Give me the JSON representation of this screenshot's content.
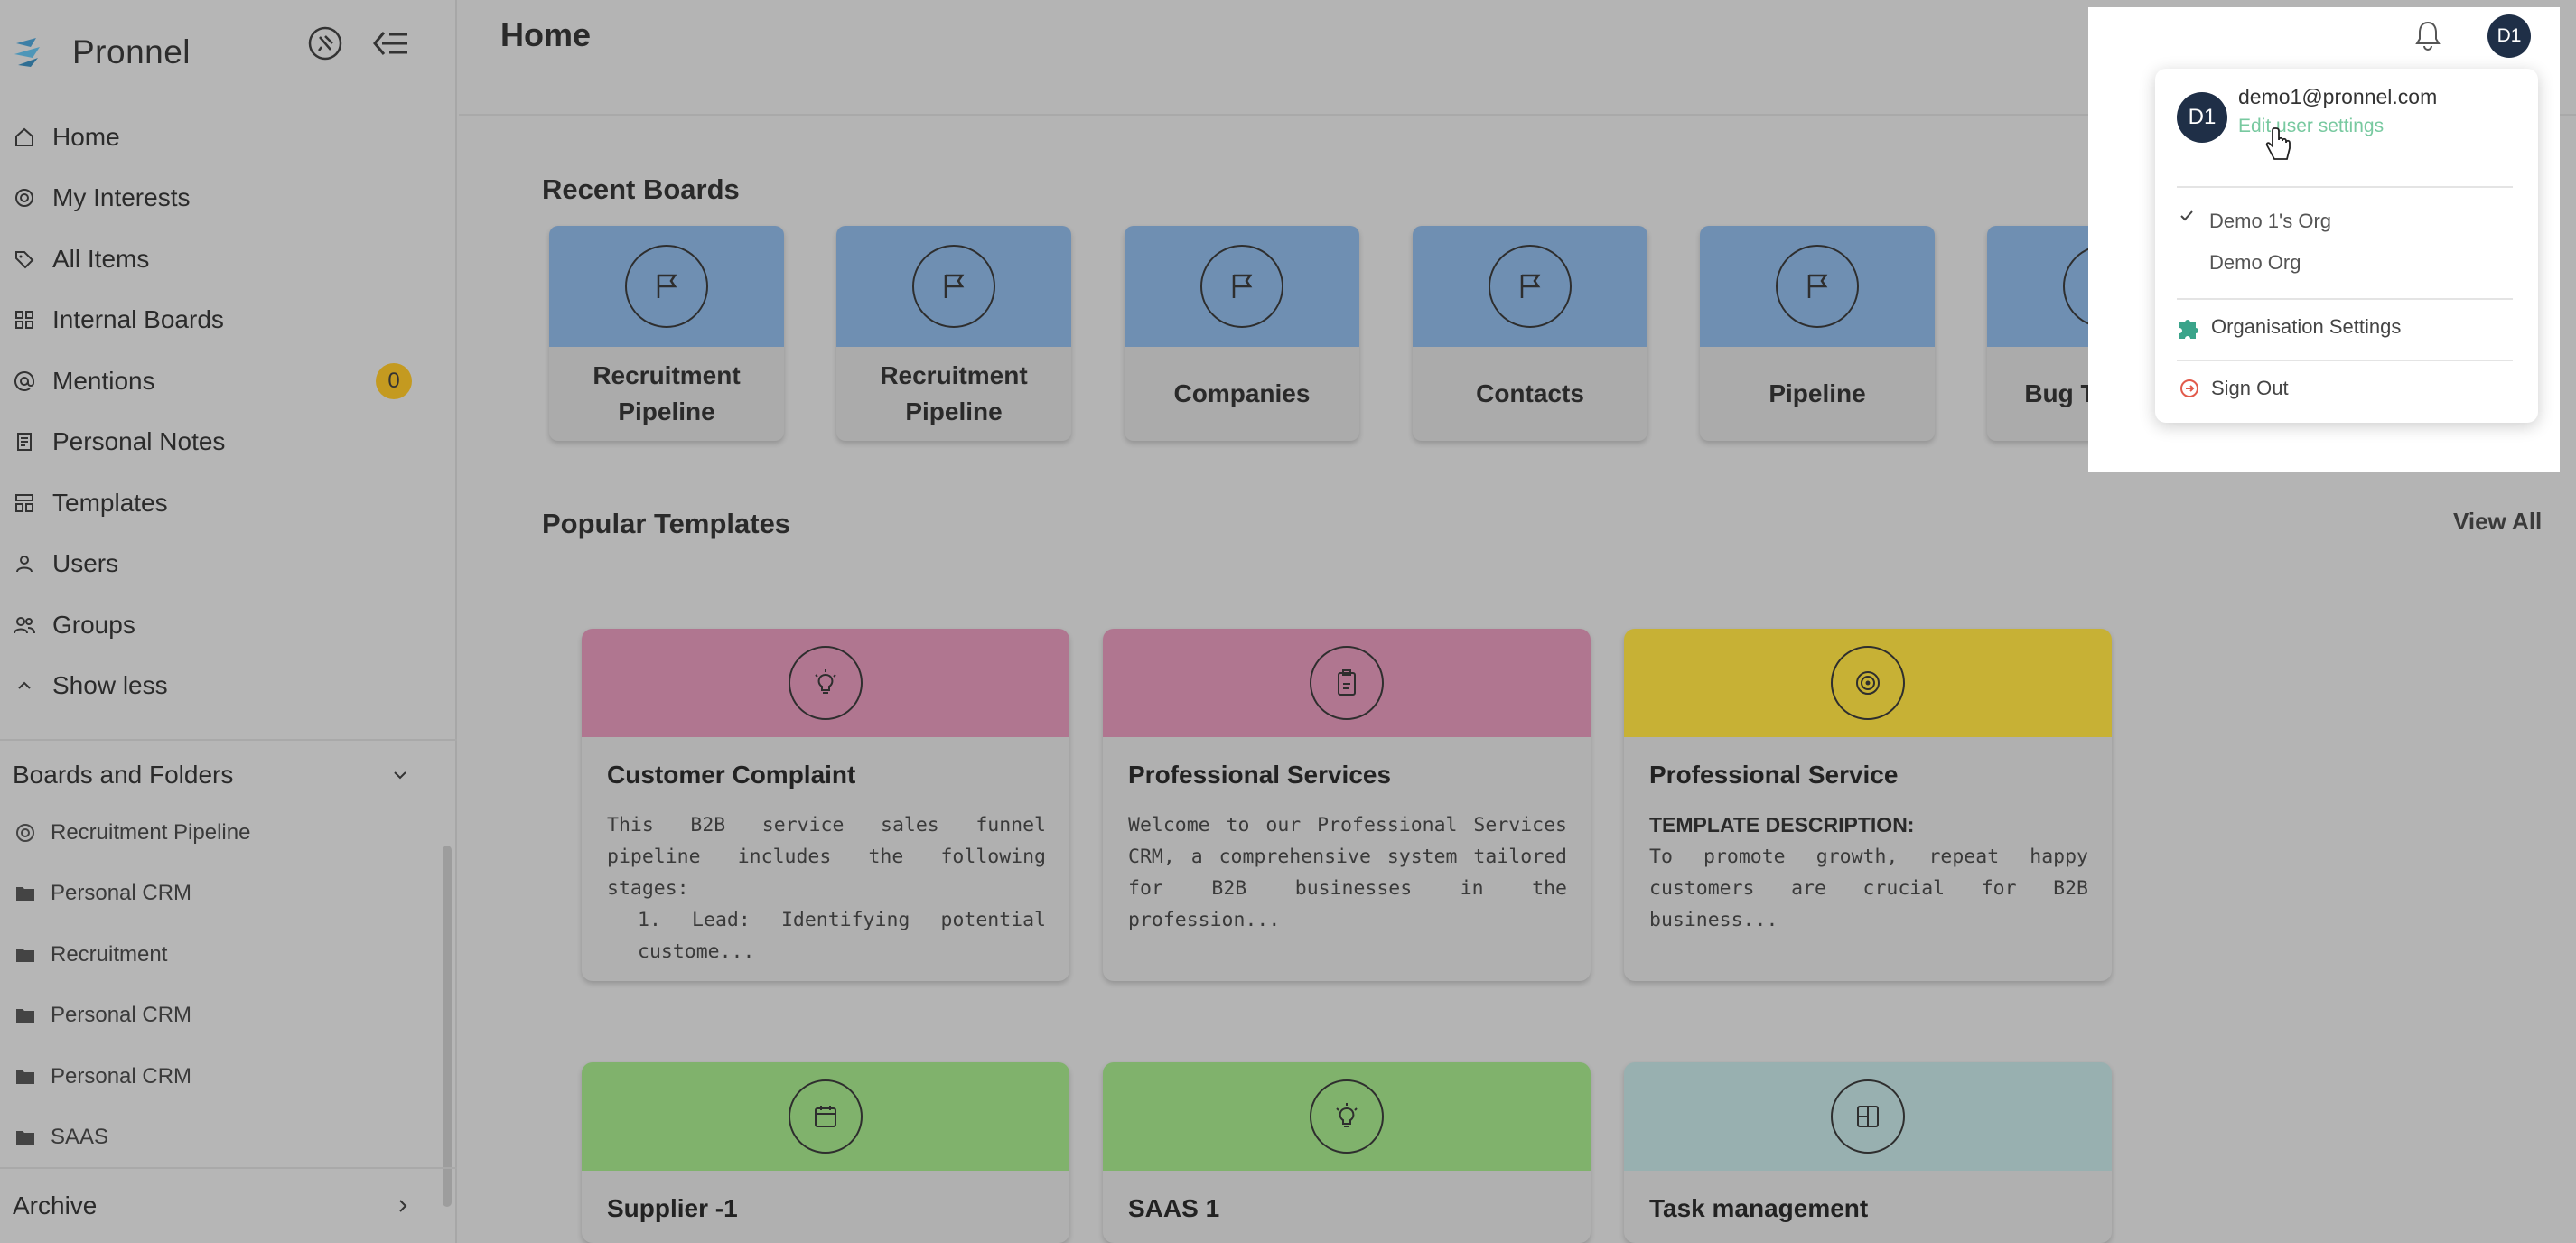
{
  "app": {
    "name": "Pronnel"
  },
  "sidebar": {
    "items": [
      {
        "label": "Home",
        "icon": "home-icon"
      },
      {
        "label": "My Interests",
        "icon": "target-icon"
      },
      {
        "label": "All Items",
        "icon": "tag-icon"
      },
      {
        "label": "Internal Boards",
        "icon": "grid-icon"
      },
      {
        "label": "Mentions",
        "icon": "at-icon",
        "badge": "0"
      },
      {
        "label": "Personal Notes",
        "icon": "note-icon"
      },
      {
        "label": "Templates",
        "icon": "template-icon"
      },
      {
        "label": "Users",
        "icon": "user-icon"
      },
      {
        "label": "Groups",
        "icon": "group-icon"
      },
      {
        "label": "Show less",
        "icon": "chevron-up-icon"
      }
    ],
    "boards_folders_label": "Boards and Folders",
    "boards_folders": [
      {
        "label": "Recruitment Pipeline",
        "icon": "target-icon"
      },
      {
        "label": "Personal CRM",
        "icon": "folder-icon"
      },
      {
        "label": "Recruitment",
        "icon": "folder-icon"
      },
      {
        "label": "Personal CRM",
        "icon": "folder-icon"
      },
      {
        "label": "Personal CRM",
        "icon": "folder-icon"
      },
      {
        "label": "SAAS",
        "icon": "folder-icon"
      }
    ],
    "archive_label": "Archive"
  },
  "main": {
    "title": "Home",
    "recent_boards_title": "Recent Boards",
    "recent_boards": [
      {
        "label": "Recruitment Pipeline"
      },
      {
        "label": "Recruitment Pipeline"
      },
      {
        "label": "Companies"
      },
      {
        "label": "Contacts"
      },
      {
        "label": "Pipeline"
      },
      {
        "label": "Bug Tracking"
      }
    ],
    "popular_templates_title": "Popular Templates",
    "view_all": "View All",
    "templates": [
      {
        "title": "Customer Complaint",
        "desc1": "This B2B service sales funnel pipeline includes the following stages:",
        "desc2": "1. Lead: Identifying potential custome...",
        "color": "#b07690",
        "icon": "lightbulb-icon"
      },
      {
        "title": "Professional Services",
        "desc1": "Welcome to our Professional Services CRM, a comprehensive system tailored for B2B businesses in the profession...",
        "color": "#b07690",
        "icon": "clipboard-icon"
      },
      {
        "title": "Professional Service",
        "desc_heading": "TEMPLATE DESCRIPTION:",
        "desc1": "To promote growth, repeat happy customers are crucial for B2B business...",
        "color": "#c7b135",
        "icon": "target-icon"
      },
      {
        "title": "Supplier -1",
        "color": "#80b26c",
        "icon": "calendar-icon"
      },
      {
        "title": "SAAS 1",
        "color": "#80b26c",
        "icon": "lightbulb-icon"
      },
      {
        "title": "Task management",
        "color": "#98b0b0",
        "icon": "layout-icon"
      }
    ]
  },
  "user_menu": {
    "avatar_initials": "D1",
    "email": "demo1@pronnel.com",
    "edit_settings": "Edit user settings",
    "orgs": [
      "Demo 1's Org",
      "Demo Org"
    ],
    "selected_org": "Demo 1's Org",
    "org_settings": "Organisation Settings",
    "sign_out": "Sign Out"
  }
}
